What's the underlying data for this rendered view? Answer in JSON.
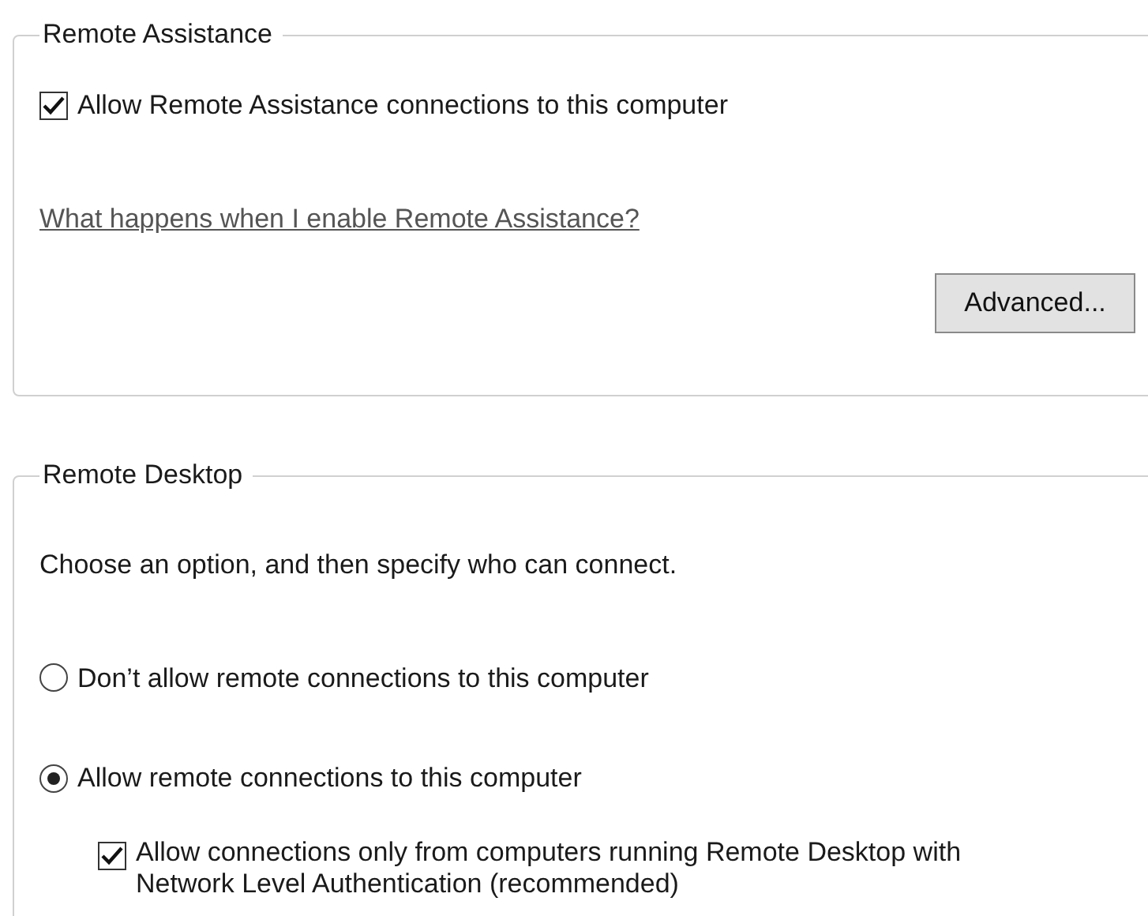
{
  "remote_assistance": {
    "title": "Remote Assistance",
    "allow_checkbox": {
      "label": "Allow Remote Assistance connections to this computer",
      "checked": true
    },
    "help_link": "What happens when I enable Remote Assistance?",
    "advanced_button": "Advanced..."
  },
  "remote_desktop": {
    "title": "Remote Desktop",
    "instruction": "Choose an option, and then specify who can connect.",
    "options": [
      {
        "label": "Don’t allow remote connections to this computer",
        "selected": false
      },
      {
        "label": "Allow remote connections to this computer",
        "selected": true
      }
    ],
    "nla_checkbox": {
      "label": "Allow connections only from computers running Remote Desktop with Network Level Authentication (recommended)",
      "checked": true
    }
  }
}
